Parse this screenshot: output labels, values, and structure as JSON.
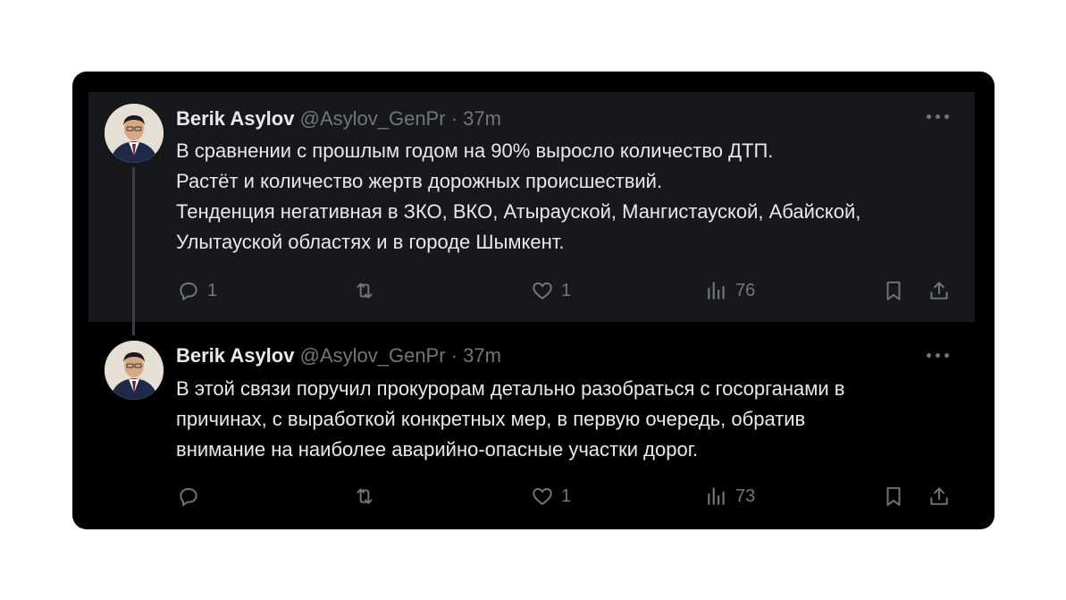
{
  "tweets": [
    {
      "author_name": "Berik Asylov",
      "handle": "@Asylov_GenPr",
      "separator": "·",
      "time": "37m",
      "lines": [
        "В сравнении с прошлым годом на 90% выросло количество ДТП.",
        "Растёт и количество жертв дорожных происшествий.",
        "Тенденция негативная в ЗКО, ВКО, Атырауской, Мангистауской, Абайской,",
        "Улытауской областях и в городе Шымкент."
      ],
      "reply_count": "1",
      "retweet_count": "",
      "like_count": "1",
      "view_count": "76"
    },
    {
      "author_name": "Berik Asylov",
      "handle": "@Asylov_GenPr",
      "separator": "·",
      "time": "37m",
      "lines": [
        "В этой связи поручил прокурорам детально разобраться с госорганами в",
        "причинах, с выработкой конкретных мер, в первую очередь, обратив",
        "внимание на наиболее аварийно-опасные участки дорог."
      ],
      "reply_count": "",
      "retweet_count": "",
      "like_count": "1",
      "view_count": "73"
    }
  ],
  "icons": {
    "reply": "reply-icon",
    "retweet": "retweet-icon",
    "like": "like-icon",
    "views": "views-icon",
    "bookmark": "bookmark-icon",
    "share": "share-icon",
    "more": "more-options-icon"
  },
  "colors": {
    "card_bg": "#000000",
    "highlight_bg": "#16181c",
    "primary_text": "#e7e9ea",
    "secondary_text": "#71767b"
  }
}
